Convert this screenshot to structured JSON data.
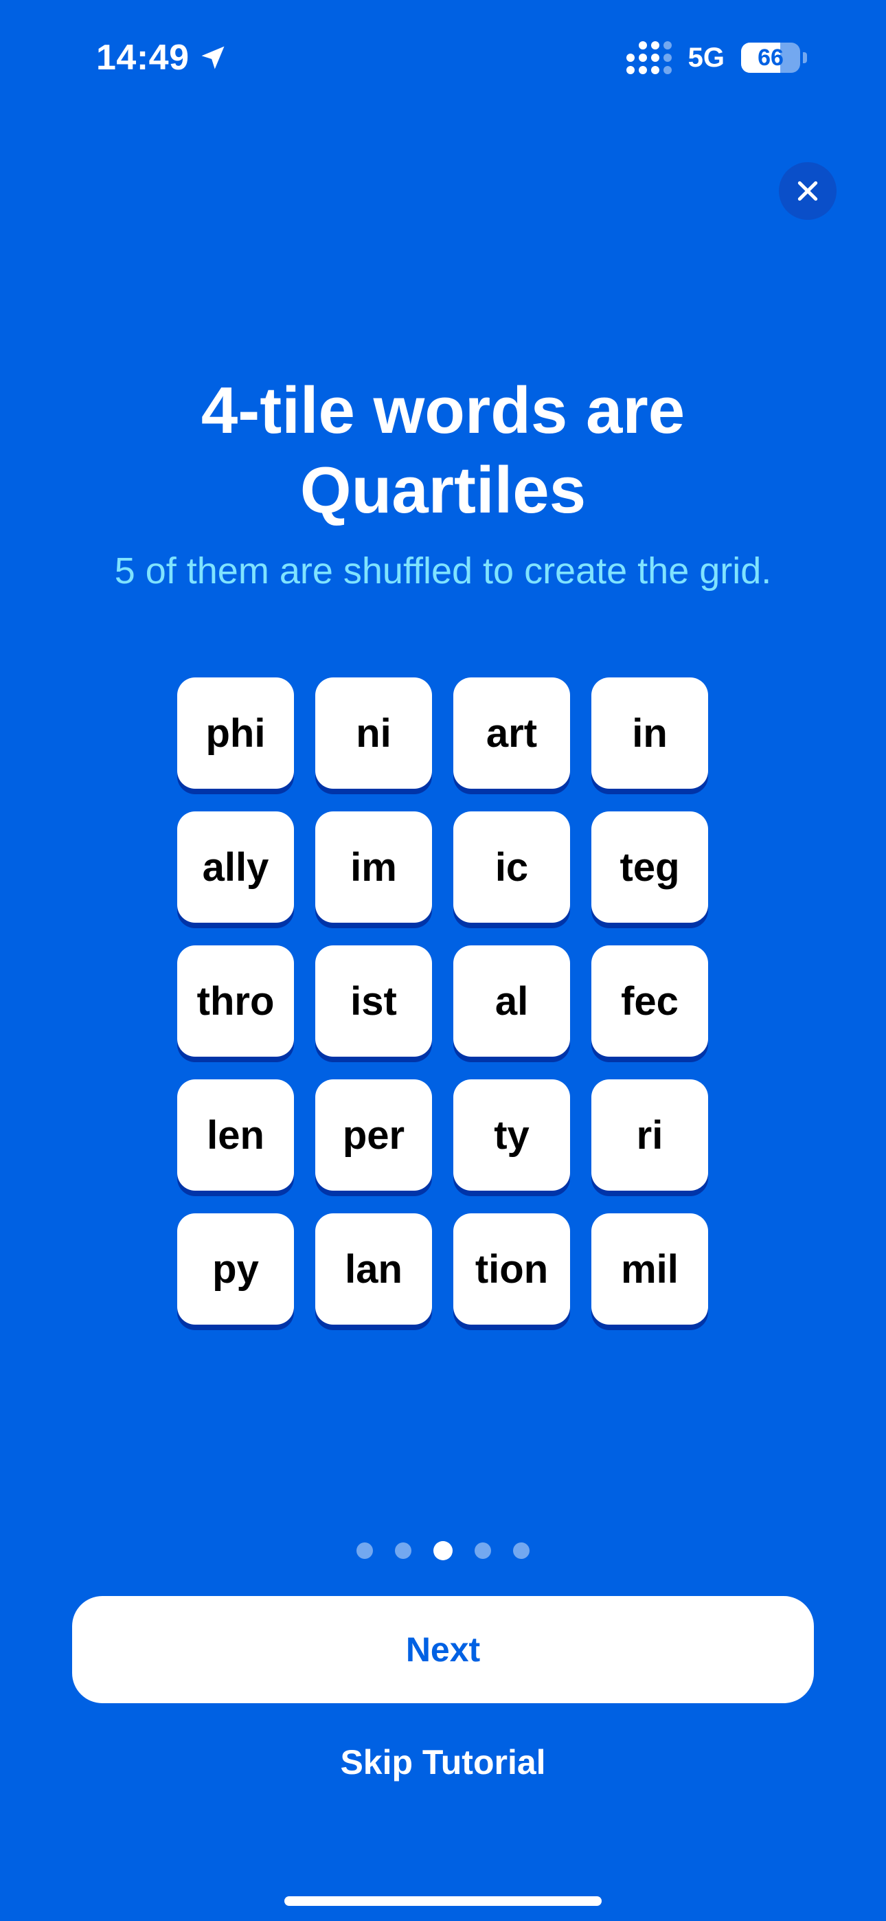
{
  "status_bar": {
    "time": "14:49",
    "network": "5G",
    "battery_level": "66",
    "battery_fraction": 0.66
  },
  "close_button": {
    "icon": "close-icon"
  },
  "headline": {
    "line1": "4-tile words are",
    "line2": "Quartiles"
  },
  "subtitle": "5 of them are shuffled to create the grid.",
  "tiles": [
    "phi",
    "ni",
    "art",
    "in",
    "ally",
    "im",
    "ic",
    "teg",
    "thro",
    "ist",
    "al",
    "fec",
    "len",
    "per",
    "ty",
    "ri",
    "py",
    "lan",
    "tion",
    "mil"
  ],
  "pager": {
    "total": 5,
    "current": 3
  },
  "actions": {
    "next_label": "Next",
    "skip_label": "Skip Tutorial"
  },
  "colors": {
    "background": "#0061E3",
    "subtitle": "#7FE3FF",
    "tile_shadow": "#0034A8"
  }
}
